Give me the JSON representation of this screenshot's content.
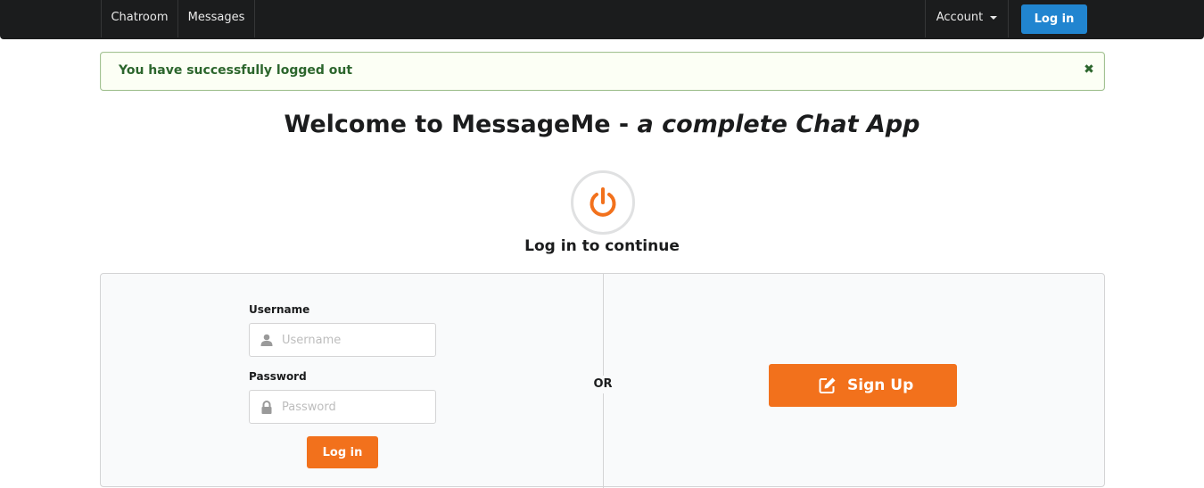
{
  "nav": {
    "chatroom": "Chatroom",
    "messages": "Messages",
    "account": "Account",
    "login": "Log in"
  },
  "message": {
    "text": "You have successfully logged out",
    "close_icon": "close-icon"
  },
  "headline": {
    "main": "Welcome to MessageMe - ",
    "emphasis": "a complete Chat App"
  },
  "power_icon": "power-icon",
  "subheading": "Log in to continue",
  "form": {
    "username_label": "Username",
    "username_placeholder": "Username",
    "password_label": "Password",
    "password_placeholder": "Password",
    "login_button": "Log in"
  },
  "divider": "OR",
  "signup": {
    "label": "Sign Up",
    "icon": "edit-icon"
  },
  "colors": {
    "primary": "#2185d0",
    "orange": "#f2711c",
    "success_text": "#2c662d",
    "success_bg": "#fcfff5",
    "navbar": "#1b1c1d"
  }
}
